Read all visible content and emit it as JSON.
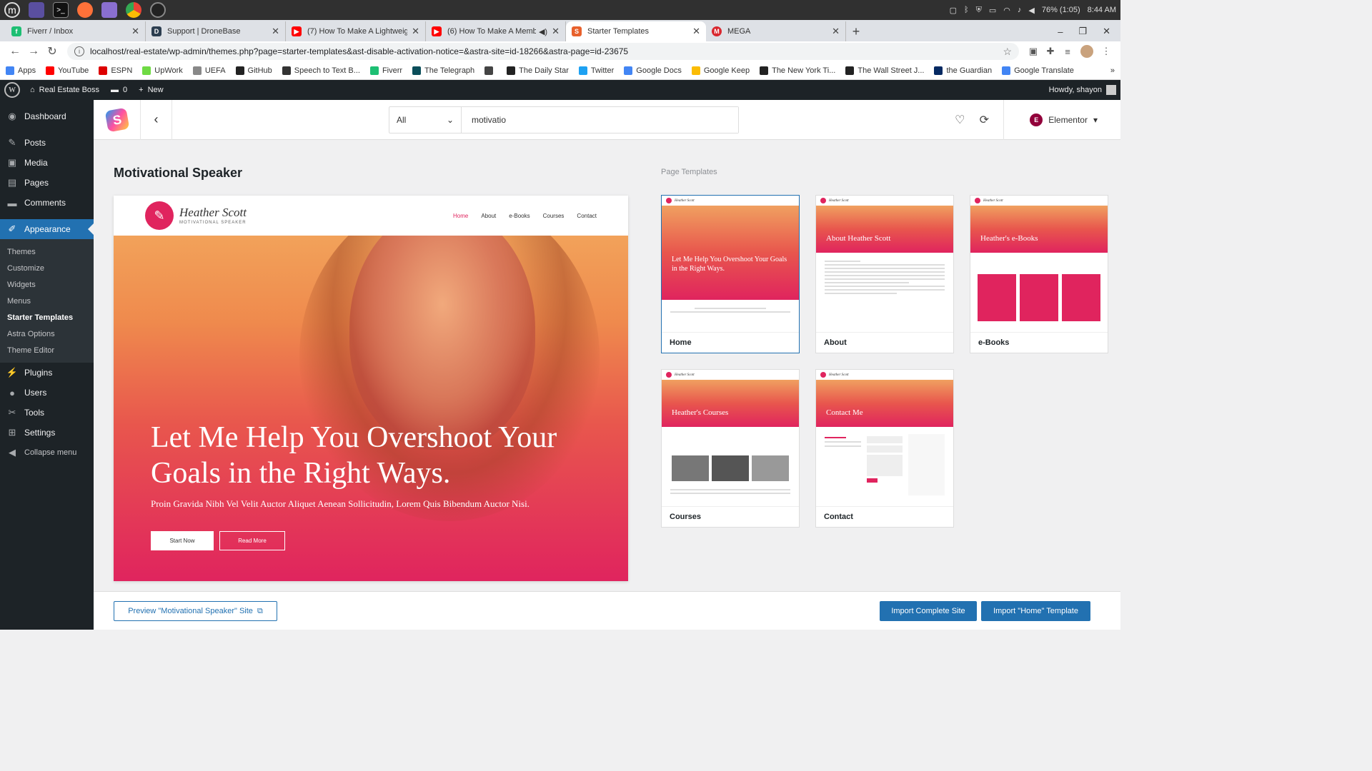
{
  "system": {
    "battery": "76% (1:05)",
    "time": "8:44 AM"
  },
  "browser": {
    "tabs": [
      {
        "title": "Fiverr / Inbox",
        "color": "#1dbf73",
        "glyph": "f"
      },
      {
        "title": "Support | DroneBase",
        "color": "#2c3e50",
        "glyph": "D"
      },
      {
        "title": "(7) How To Make A Lightweig",
        "color": "#ff0000",
        "glyph": "▶"
      },
      {
        "title": "(6) How To Make A Membe",
        "color": "#ff0000",
        "glyph": "▶"
      },
      {
        "title": "Starter Templates",
        "color": "#e8612c",
        "glyph": "S"
      },
      {
        "title": "MEGA",
        "color": "#d9272e",
        "glyph": "M"
      }
    ],
    "url": "localhost/real-estate/wp-admin/themes.php?page=starter-templates&ast-disable-activation-notice=&astra-site=id-18266&astra-page=id-23675",
    "bookmarks": [
      {
        "label": "Apps",
        "color": "#4285f4"
      },
      {
        "label": "YouTube",
        "color": "#ff0000"
      },
      {
        "label": "ESPN",
        "color": "#d00"
      },
      {
        "label": "UpWork",
        "color": "#6fda44"
      },
      {
        "label": "UEFA",
        "color": "#888"
      },
      {
        "label": "GitHub",
        "color": "#222"
      },
      {
        "label": "Speech to Text B...",
        "color": "#333"
      },
      {
        "label": "Fiverr",
        "color": "#1dbf73"
      },
      {
        "label": "The Telegraph",
        "color": "#0b4e5a"
      },
      {
        "label": "",
        "color": "#444"
      },
      {
        "label": "The Daily Star",
        "color": "#222"
      },
      {
        "label": "Twitter",
        "color": "#1da1f2"
      },
      {
        "label": "Google Docs",
        "color": "#4285f4"
      },
      {
        "label": "Google Keep",
        "color": "#fbbc04"
      },
      {
        "label": "The New York Ti...",
        "color": "#222"
      },
      {
        "label": "The Wall Street J...",
        "color": "#222"
      },
      {
        "label": "the Guardian",
        "color": "#052962"
      },
      {
        "label": "Google Translate",
        "color": "#4285f4"
      }
    ]
  },
  "adminbar": {
    "site": "Real Estate Boss",
    "comments": "0",
    "new": "New",
    "howdy": "Howdy, shayon"
  },
  "sidebar": {
    "items": [
      {
        "label": "Dashboard",
        "icon": "◉"
      },
      {
        "label": "Posts",
        "icon": "✎"
      },
      {
        "label": "Media",
        "icon": "▣"
      },
      {
        "label": "Pages",
        "icon": "▤"
      },
      {
        "label": "Comments",
        "icon": "▬"
      },
      {
        "label": "Appearance",
        "icon": "✐"
      }
    ],
    "submenu": [
      "Themes",
      "Customize",
      "Widgets",
      "Menus",
      "Starter Templates",
      "Astra Options",
      "Theme Editor"
    ],
    "items2": [
      {
        "label": "Plugins",
        "icon": "⚡"
      },
      {
        "label": "Users",
        "icon": "●"
      },
      {
        "label": "Tools",
        "icon": "✂"
      },
      {
        "label": "Settings",
        "icon": "⊞"
      },
      {
        "label": "Collapse menu",
        "icon": "◀"
      }
    ]
  },
  "header": {
    "filter": "All",
    "search": "motivatio",
    "builder": "Elementor"
  },
  "site_title": "Motivational Speaker",
  "page_templates_label": "Page Templates",
  "preview": {
    "logo_name": "Heather Scott",
    "logo_sub": "MOTIVATIONAL SPEAKER",
    "nav": [
      "Home",
      "About",
      "e-Books",
      "Courses",
      "Contact"
    ],
    "headline": "Let Me Help You Overshoot Your Goals in the Right Ways.",
    "subtext": "Proin Gravida Nibh Vel Velit Auctor Aliquet Aenean Sollicitudin, Lorem Quis Bibendum Auctor Nisi.",
    "btn1": "Start Now",
    "btn2": "Read More"
  },
  "templates": [
    {
      "name": "Home",
      "hero": "Let Me Help You Overshoot Your Goals in the Right Ways."
    },
    {
      "name": "About",
      "hero": "About Heather Scott"
    },
    {
      "name": "e-Books",
      "hero": "Heather's e-Books"
    },
    {
      "name": "Courses",
      "hero": "Heather's Courses"
    },
    {
      "name": "Contact",
      "hero": "Contact Me"
    }
  ],
  "footer": {
    "preview_btn": "Preview \"Motivational Speaker\" Site",
    "import_site": "Import Complete Site",
    "import_template": "Import \"Home\" Template"
  }
}
